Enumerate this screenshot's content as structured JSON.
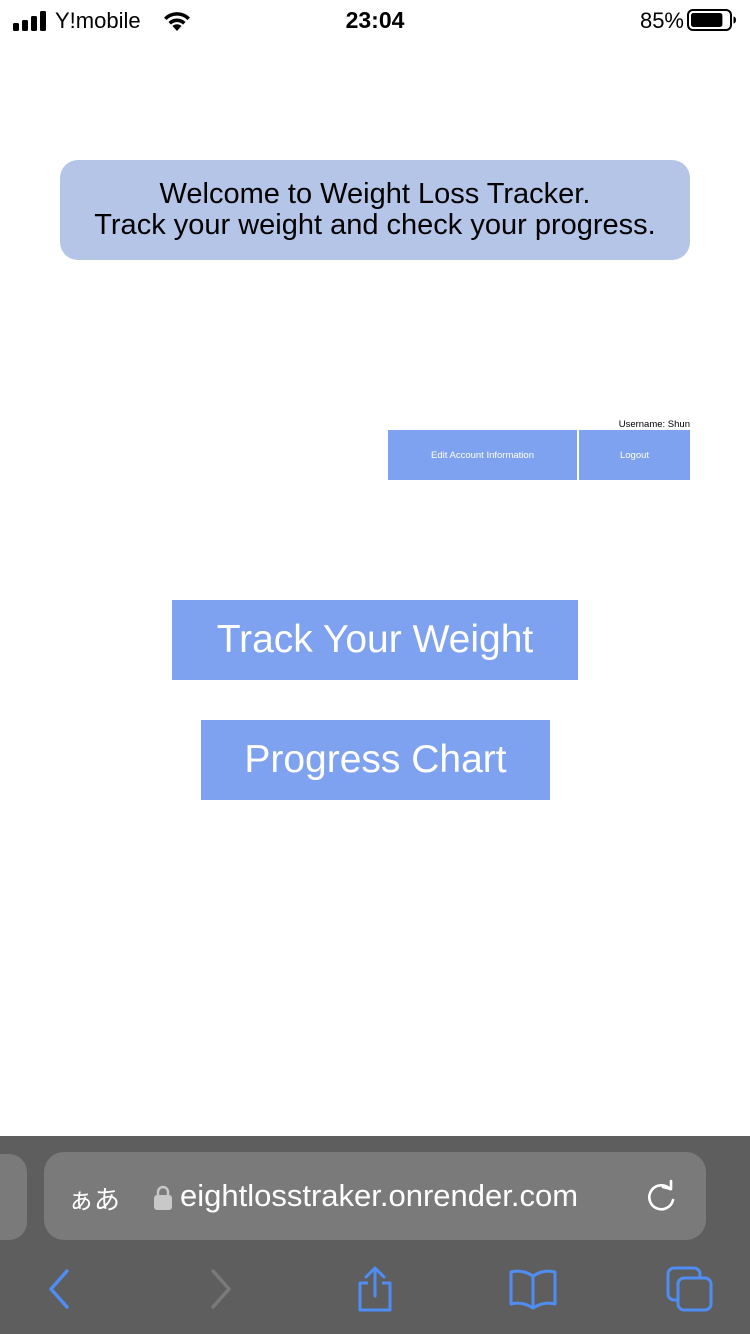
{
  "status_bar": {
    "carrier": "Y!mobile",
    "time": "23:04",
    "battery_percent": "85%",
    "battery_level": 0.85,
    "icons": [
      "signal-icon",
      "wifi-icon",
      "battery-icon"
    ]
  },
  "page": {
    "welcome_line1": "Welcome to Weight Loss Tracker.",
    "welcome_line2": "Track your weight and check your progress.",
    "username_label": "Username: Shun",
    "edit_account_label": "Edit Account Information",
    "logout_label": "Logout",
    "track_weight_label": "Track Your Weight",
    "progress_chart_label": "Progress Chart"
  },
  "browser": {
    "text_size_label": "ぁあ",
    "url": "eightlosstraker.onrender.com",
    "icons": [
      "lock-icon",
      "reload-icon",
      "back-icon",
      "forward-icon",
      "share-icon",
      "bookmarks-icon",
      "tabs-icon"
    ]
  },
  "colors": {
    "button_blue": "#7ea2ef",
    "banner_blue": "#b4c5e8",
    "toolbar_blue": "#4f8df5"
  }
}
